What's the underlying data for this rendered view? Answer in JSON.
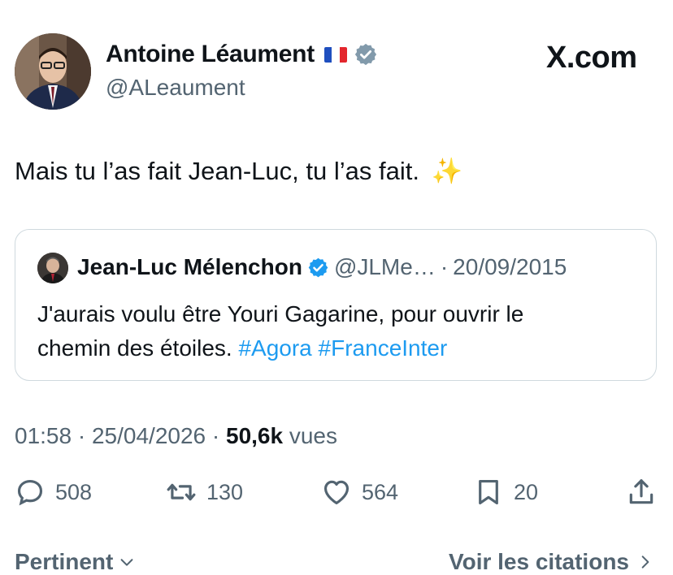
{
  "author": {
    "name": "Antoine Léaument",
    "handle": "@ALeaument",
    "flag": "french-flag-icon",
    "verified": "verified-badge-icon"
  },
  "brand": {
    "text": "X.com"
  },
  "tweet": {
    "text": "Mais tu l’as fait Jean-Luc, tu l’as fait.",
    "emoji": "✨"
  },
  "quote": {
    "name": "Jean-Luc Mélenchon",
    "handle": "@JLMe…",
    "separator": "·",
    "date": "20/09/2015",
    "text_line1": "J'aurais voulu être Youri Gagarine, pour ouvrir le",
    "text_line2": "chemin des étoiles.",
    "hashtag1": "#Agora",
    "hashtag2": "#FranceInter"
  },
  "meta": {
    "time": "01:58",
    "sep1": "·",
    "date": "25/04/2026",
    "sep2": "·",
    "views_count": "50,6k",
    "views_label": "vues"
  },
  "actions": {
    "replies": "508",
    "reposts": "130",
    "likes": "564",
    "bookmarks": "20"
  },
  "footer": {
    "sort_label": "Pertinent",
    "citations_label": "Voir les citations"
  },
  "colors": {
    "link": "#1d9bf0",
    "muted": "#536471",
    "text": "#0f1419",
    "border": "#cfd9de"
  }
}
